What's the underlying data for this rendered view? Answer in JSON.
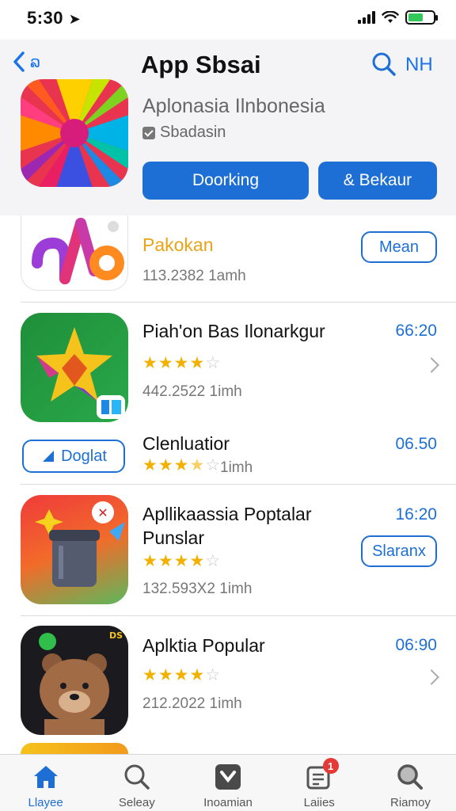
{
  "status": {
    "time": "5:30"
  },
  "header": {
    "back_label": "ລ",
    "title": "App Sbsai",
    "action_label": "NH"
  },
  "hero": {
    "name": "Aplonasia Ilnbonesia",
    "subtitle": "Sbadasin",
    "primary_button": "Doorking",
    "secondary_button": "& Bekaur"
  },
  "apps": [
    {
      "name": "Pakokan",
      "meta": "113.2382 1amh",
      "button": "Mean",
      "name_color": "#e8a317"
    },
    {
      "name": "Piah'on Bas Ilonarkgur",
      "meta": "442.2522 1imh",
      "price": "66:20",
      "rating": 4
    },
    {
      "name": "Clenluatior",
      "meta": "1imh",
      "price": "06.50",
      "button": "Doglat",
      "rating": 3.5
    },
    {
      "name": "Apllikaassia Poptalar Punslar",
      "meta": "132.593X2 1imh",
      "price": "16:20",
      "button": "Slaranx",
      "rating": 4
    },
    {
      "name": "Aplktia Popular",
      "meta": "212.2022 1imh",
      "price": "06:90",
      "rating": 4
    }
  ],
  "tabs": [
    {
      "label": "Llayee",
      "icon": "home-icon",
      "active": true
    },
    {
      "label": "Seleay",
      "icon": "search-icon"
    },
    {
      "label": "Inoamian",
      "icon": "apps-icon"
    },
    {
      "label": "Laiies",
      "icon": "updates-icon",
      "badge": "1"
    },
    {
      "label": "Riamoy",
      "icon": "search-icon"
    }
  ],
  "colors": {
    "accent": "#1d6fd6",
    "star": "#f2b100",
    "header_bg": "#f4f4f6"
  }
}
